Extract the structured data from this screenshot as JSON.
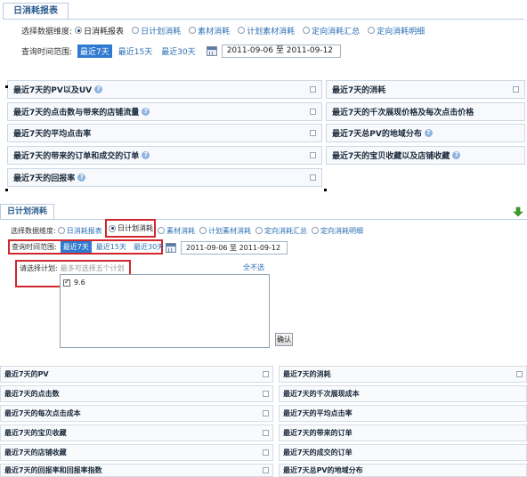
{
  "top_panel": {
    "tab_label": "日消耗报表",
    "dimension_label": "选择数据维度:",
    "dimension_options": [
      {
        "label": "日消耗报表",
        "selected": true
      },
      {
        "label": "日计划消耗",
        "selected": false
      },
      {
        "label": "素材消耗",
        "selected": false
      },
      {
        "label": "计划素材消耗",
        "selected": false
      },
      {
        "label": "定向消耗汇总",
        "selected": false
      },
      {
        "label": "定向消耗明细",
        "selected": false
      }
    ],
    "range_label": "查询时间范围:",
    "range_options": [
      "最近7天",
      "最近15天",
      "最近30天"
    ],
    "date_range": "2011-09-06 至 2011-09-12",
    "cards_left": [
      {
        "title": "最近7天的PV以及UV",
        "help": true
      },
      {
        "title": "最近7天的点击数与带来的店铺流量",
        "help": true
      },
      {
        "title": "最近7天的平均点击率",
        "help": false
      },
      {
        "title": "最近7天的带来的订单和成交的订单",
        "help": true
      },
      {
        "title": "最近7天的回报率",
        "help": true
      }
    ],
    "cards_right": [
      {
        "title": "最近7天的消耗",
        "help": false
      },
      {
        "title": "最近7天的千次展现价格及每次点击价格",
        "help": false
      },
      {
        "title": "最近7天总PV的地域分布",
        "help": true
      },
      {
        "title": "最近7天的宝贝收藏以及店铺收藏",
        "help": true
      }
    ]
  },
  "bottom_panel": {
    "tab_label": "日计划消耗",
    "dimension_label": "选择数据维度:",
    "dimension_options": [
      {
        "label": "日消耗报表",
        "selected": false
      },
      {
        "label": "日计划消耗",
        "selected": true
      },
      {
        "label": "素材消耗",
        "selected": false
      },
      {
        "label": "计划素材消耗",
        "selected": false
      },
      {
        "label": "定向消耗汇总",
        "selected": false
      },
      {
        "label": "定向消耗明细",
        "selected": false
      }
    ],
    "range_label": "查询时间范围:",
    "range_options": [
      "最近7天",
      "最近15天",
      "最近30天"
    ],
    "date_range": "2011-09-06 至 2011-09-12",
    "plan_label": "请选择计划:",
    "plan_hint": "最多可选择五个计划",
    "deselect_all": "全不选",
    "plans": [
      {
        "label": "9.6",
        "checked": true
      }
    ],
    "confirm_label": "确认",
    "cards_left": [
      "最近7天的PV",
      "最近7天的点击数",
      "最近7天的每次点击成本",
      "最近7天的宝贝收藏",
      "最近7天的店铺收藏",
      "最近7天的回报率和回报率指数"
    ],
    "cards_right": [
      "最近7天的消耗",
      "最近7天的千次展现成本",
      "最近7天的平均点击率",
      "最近7天的带来的订单",
      "最近7天的成交的订单",
      "最近7天总PV的地域分布"
    ]
  },
  "colors": {
    "accent": "#2f7ad0",
    "highlight_box": "#d0262d",
    "arrow": "#3aa02a"
  }
}
